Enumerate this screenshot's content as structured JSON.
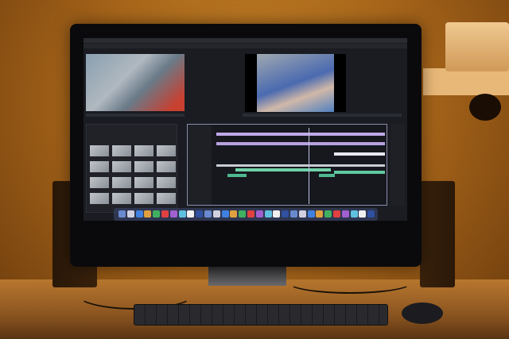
{
  "scene": {
    "subject": "video-editing-workstation",
    "colors": {
      "wall": "#b8762a",
      "screen_bg": "#1a1c22",
      "timeline_purple": "#b8a0e0",
      "timeline_green": "#60c8a0",
      "dock": "#3c466e"
    }
  },
  "screen": {
    "bin_thumbnails": 16,
    "dock_icons": 30
  }
}
